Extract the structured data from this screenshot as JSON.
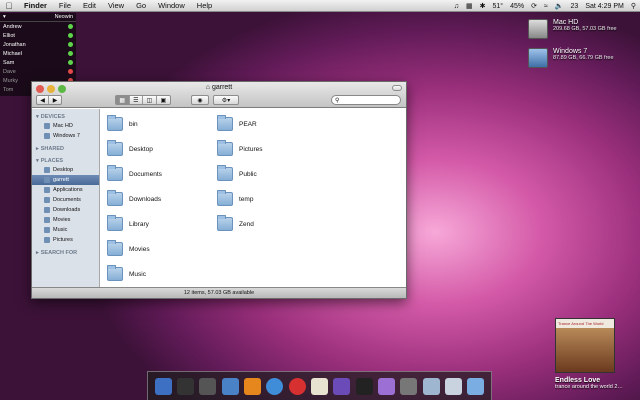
{
  "menubar": {
    "app": "Finder",
    "items": [
      "File",
      "Edit",
      "View",
      "Go",
      "Window",
      "Help"
    ],
    "status": {
      "temp": "51°",
      "battery": "45%",
      "clock": "Sat 4:29 PM",
      "date_badge": "23"
    }
  },
  "neowin": {
    "title": "Neowin",
    "contacts": [
      {
        "name": "Andrew",
        "online": true
      },
      {
        "name": "Elliot",
        "online": true
      },
      {
        "name": "Jonathan",
        "online": true
      },
      {
        "name": "Michael",
        "online": true
      },
      {
        "name": "Sam",
        "online": true
      },
      {
        "name": "Dave",
        "online": false
      },
      {
        "name": "Murky",
        "online": false
      },
      {
        "name": "Tom",
        "online": false
      }
    ]
  },
  "desktop": {
    "drives": [
      {
        "name": "Mac HD",
        "info": "209.68 GB, 57.03 GB free"
      },
      {
        "name": "Windows 7",
        "info": "87.89 GB, 66.79 GB free"
      }
    ]
  },
  "finder": {
    "title": "garrett",
    "sidebar": {
      "devices_label": "DEVICES",
      "devices": [
        "Mac HD",
        "Windows 7"
      ],
      "shared_label": "SHARED",
      "places_label": "PLACES",
      "places": [
        "Desktop",
        "garrett",
        "Applications",
        "Documents",
        "Downloads",
        "Movies",
        "Music",
        "Pictures"
      ],
      "search_label": "SEARCH FOR"
    },
    "files_col1": [
      "bin",
      "Desktop",
      "Documents",
      "Downloads",
      "Library",
      "Movies",
      "Music"
    ],
    "files_col2": [
      "PEAR",
      "Pictures",
      "Public",
      "temp",
      "Zend"
    ],
    "status": "12 items, 57.03 GB available"
  },
  "itunes": {
    "song": "Endless Love",
    "album": "trance around the world 2…",
    "art_text": "Trance Around The World"
  },
  "colors": {
    "online": "#5fd34a",
    "offline": "#e44a4a",
    "selection": "#4a6a98"
  }
}
